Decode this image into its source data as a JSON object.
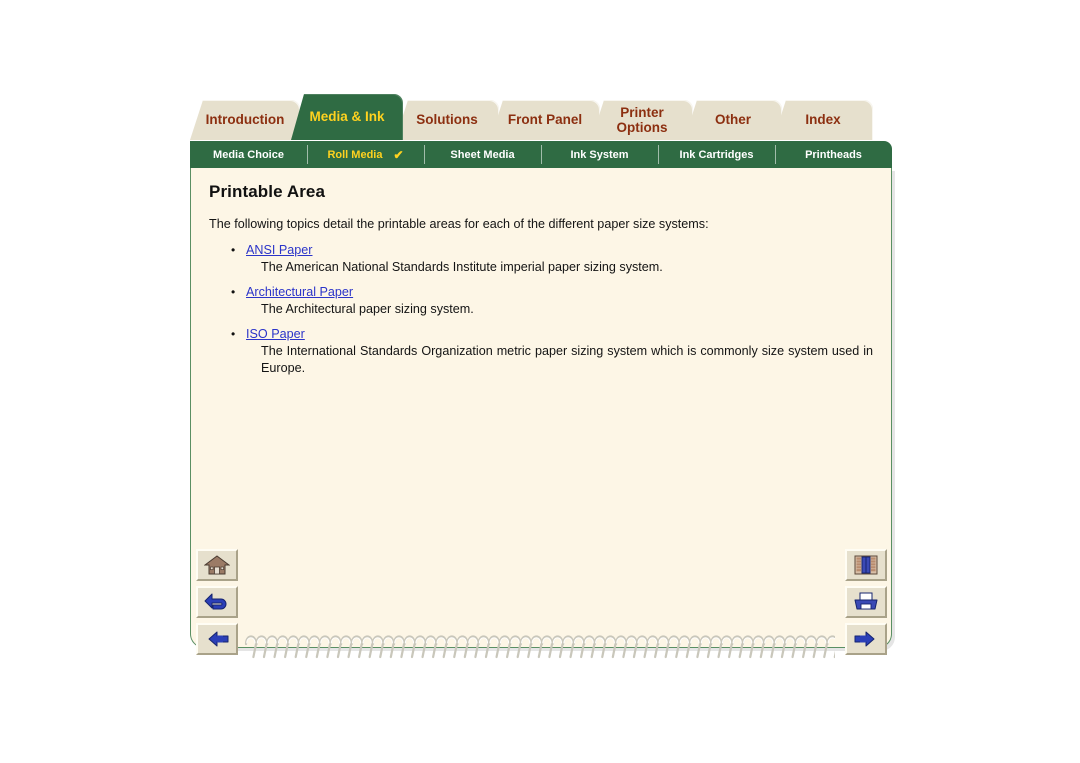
{
  "colors": {
    "tab_active_bg": "#2f6b43",
    "tab_active_text": "#ffd21f",
    "tab_inactive_bg": "#e6e0cd",
    "tab_inactive_text": "#8c2f10",
    "page_bg": "#fdf6e6",
    "page_border": "#5a8f63",
    "link": "#2b34c9",
    "app_bg": "#ffffff"
  },
  "tabs": [
    {
      "label": "Introduction",
      "active": false
    },
    {
      "label": "Media & Ink",
      "active": true
    },
    {
      "label": "Solutions",
      "active": false
    },
    {
      "label": "Front Panel",
      "active": false
    },
    {
      "label": "Printer\nOptions",
      "active": false
    },
    {
      "label": "Other",
      "active": false
    },
    {
      "label": "Index",
      "active": false
    }
  ],
  "subtabs": [
    {
      "label": "Media Choice",
      "active": false,
      "check": ""
    },
    {
      "label": "Roll Media",
      "active": true,
      "check": "✔"
    },
    {
      "label": "Sheet Media",
      "active": false,
      "check": ""
    },
    {
      "label": "Ink System",
      "active": false,
      "check": ""
    },
    {
      "label": "Ink Cartridges",
      "active": false,
      "check": ""
    },
    {
      "label": "Printheads",
      "active": false,
      "check": ""
    }
  ],
  "content": {
    "title": "Printable Area",
    "intro": "The following topics detail the printable areas for each of the different paper size systems:",
    "bullet": "•",
    "topics": [
      {
        "link": "ANSI Paper",
        "desc": "The American National Standards Institute imperial paper sizing system."
      },
      {
        "link": "Architectural Paper",
        "desc": "The Architectural paper sizing system."
      },
      {
        "link": "ISO Paper",
        "desc": "The International Standards Organization metric paper sizing system which is commonly size system used in Europe."
      }
    ]
  },
  "nav_left": [
    {
      "icon": "home-icon",
      "title": "Home"
    },
    {
      "icon": "back-arrow-icon",
      "title": "Back"
    },
    {
      "icon": "hand-left-icon",
      "title": "Previous page"
    }
  ],
  "nav_right": [
    {
      "icon": "index-book-icon",
      "title": "Index"
    },
    {
      "icon": "printer-icon",
      "title": "Print"
    },
    {
      "icon": "hand-right-icon",
      "title": "Next page"
    }
  ]
}
